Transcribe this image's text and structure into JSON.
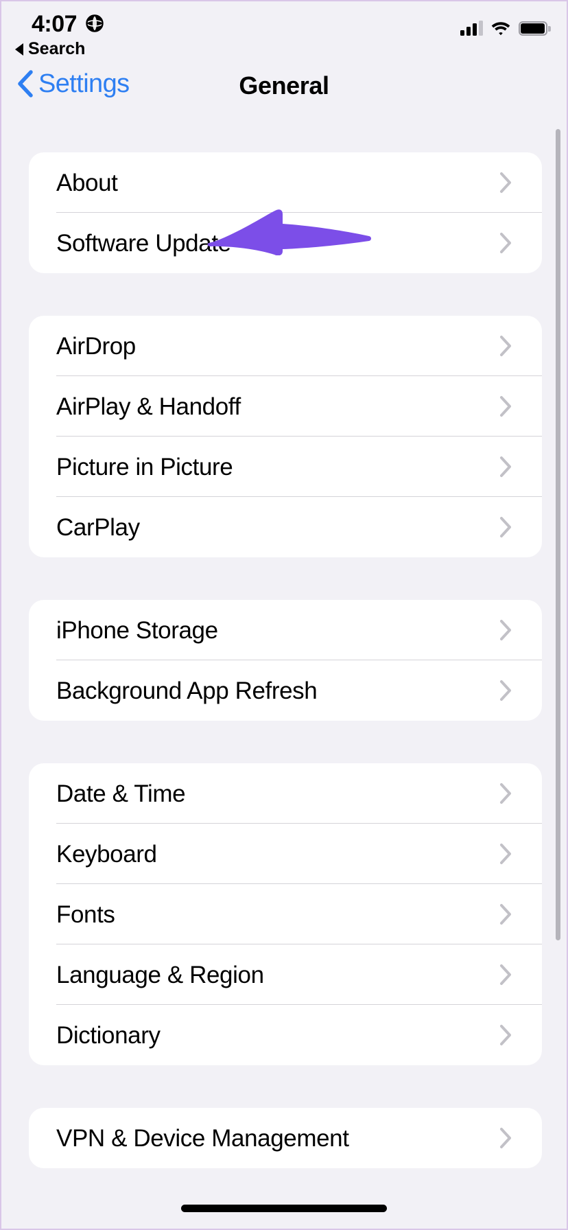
{
  "status_bar": {
    "time": "4:07",
    "vpn_icon": "globe-icon",
    "cellular_icon": "cellular-signal-icon",
    "cellular_bars_filled": 3,
    "cellular_bars_total": 4,
    "wifi_icon": "wifi-icon",
    "battery_icon": "battery-full-icon"
  },
  "back_to_app": {
    "icon": "back-triangle-icon",
    "label": "Search"
  },
  "nav": {
    "back_icon": "chevron-left-icon",
    "back_label": "Settings",
    "title": "General"
  },
  "annotation": {
    "type": "arrow-left",
    "color": "#7c4ee8",
    "points_to": "Software Update"
  },
  "scrollbar": {
    "name": "vertical-scrollbar"
  },
  "home_indicator": {
    "name": "home-indicator"
  },
  "sections": [
    {
      "rows": [
        {
          "label": "About",
          "accessory": "chevron-right-icon"
        },
        {
          "label": "Software Update",
          "accessory": "chevron-right-icon"
        }
      ]
    },
    {
      "rows": [
        {
          "label": "AirDrop",
          "accessory": "chevron-right-icon"
        },
        {
          "label": "AirPlay & Handoff",
          "accessory": "chevron-right-icon"
        },
        {
          "label": "Picture in Picture",
          "accessory": "chevron-right-icon"
        },
        {
          "label": "CarPlay",
          "accessory": "chevron-right-icon"
        }
      ]
    },
    {
      "rows": [
        {
          "label": "iPhone Storage",
          "accessory": "chevron-right-icon"
        },
        {
          "label": "Background App Refresh",
          "accessory": "chevron-right-icon"
        }
      ]
    },
    {
      "rows": [
        {
          "label": "Date & Time",
          "accessory": "chevron-right-icon"
        },
        {
          "label": "Keyboard",
          "accessory": "chevron-right-icon"
        },
        {
          "label": "Fonts",
          "accessory": "chevron-right-icon"
        },
        {
          "label": "Language & Region",
          "accessory": "chevron-right-icon"
        },
        {
          "label": "Dictionary",
          "accessory": "chevron-right-icon"
        }
      ]
    },
    {
      "rows": [
        {
          "label": "VPN & Device Management",
          "accessory": "chevron-right-icon"
        }
      ]
    }
  ],
  "colors": {
    "background": "#f2f1f6",
    "card": "#ffffff",
    "separator": "#d4d3d8",
    "accent_blue": "#2e7ff2",
    "chevron_gray": "#c2c1c7",
    "annotation_purple": "#7c4ee8"
  }
}
